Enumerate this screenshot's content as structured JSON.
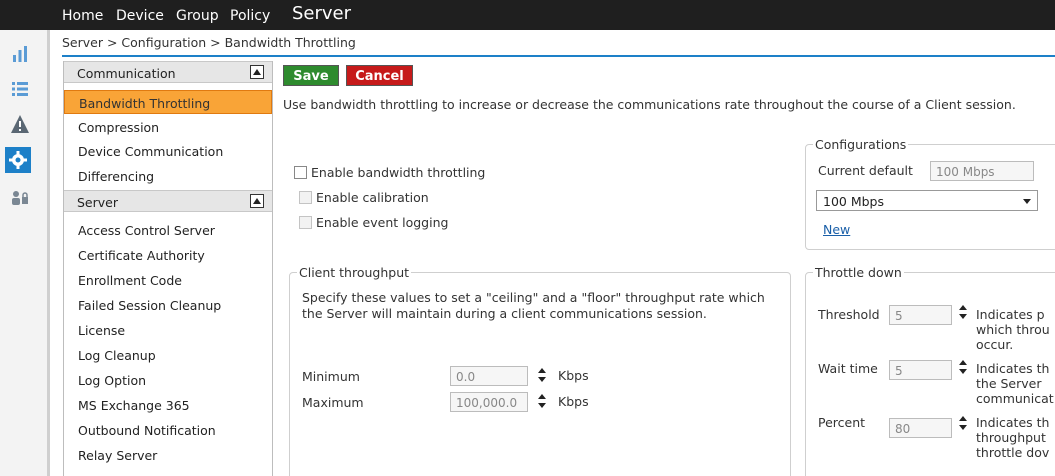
{
  "topnav": {
    "items": [
      "Home",
      "Device",
      "Group",
      "Policy"
    ],
    "active": "Server"
  },
  "rail": {
    "icons": [
      "bar-chart-icon",
      "list-icon",
      "warning-icon",
      "gear-icon",
      "users-lock-icon"
    ],
    "active_color": "#1d80c8"
  },
  "breadcrumb": "Server > Configuration > Bandwidth Throttling",
  "sidebar": {
    "communication": {
      "title": "Communication",
      "items": [
        "Bandwidth Throttling",
        "Compression",
        "Device Communication",
        "Differencing"
      ],
      "selected": "Bandwidth Throttling"
    },
    "server": {
      "title": "Server",
      "items": [
        "Access Control Server",
        "Certificate Authority",
        "Enrollment Code",
        "Failed Session Cleanup",
        "License",
        "Log Cleanup",
        "Log Option",
        "MS Exchange 365",
        "Outbound Notification",
        "Relay Server"
      ]
    }
  },
  "toolbar": {
    "save_label": "Save",
    "cancel_label": "Cancel"
  },
  "description": "Use bandwidth throttling to increase or decrease the communications rate throughout the course of a Client session.",
  "checkboxes": {
    "enable_throttling": "Enable bandwidth throttling",
    "enable_calibration": "Enable calibration",
    "enable_logging": "Enable event logging"
  },
  "configurations": {
    "legend": "Configurations",
    "current_default_label": "Current default",
    "current_default_value": "100 Mbps",
    "select_value": "100 Mbps",
    "new_link": "New"
  },
  "client_throughput": {
    "legend": "Client throughput",
    "description": "Specify these values to set a \"ceiling\" and a \"floor\" throughput rate which the Server will maintain during a client communications session.",
    "minimum_label": "Minimum",
    "minimum_value": "0.0",
    "maximum_label": "Maximum",
    "maximum_value": "100,000.0",
    "unit": "Kbps"
  },
  "throttle_down": {
    "legend": "Throttle down",
    "threshold_label": "Threshold",
    "threshold_value": "5",
    "threshold_desc_1": "Indicates p",
    "threshold_desc_2": "which throu",
    "threshold_desc_3": "occur.",
    "wait_label": "Wait time",
    "wait_value": "5",
    "wait_desc_1": "Indicates th",
    "wait_desc_2": "the Server",
    "wait_desc_3": "communicat",
    "percent_label": "Percent",
    "percent_value": "80",
    "percent_desc_1": "Indicates th",
    "percent_desc_2": "throughput",
    "percent_desc_3": "throttle dov"
  }
}
